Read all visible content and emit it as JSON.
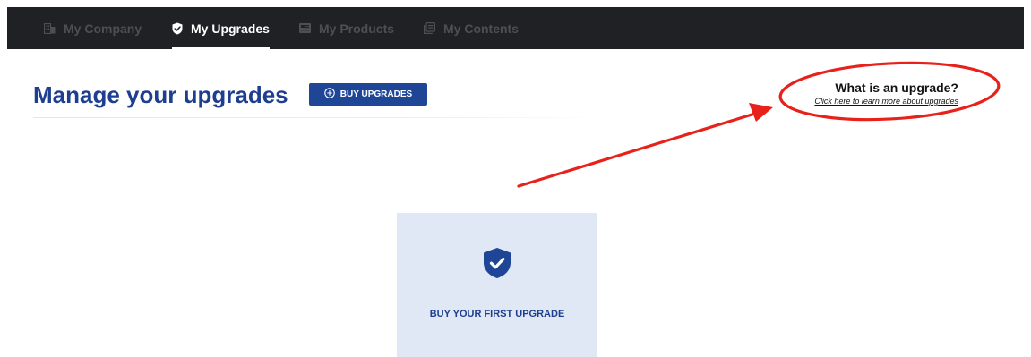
{
  "nav": {
    "tabs": [
      {
        "label": "My Company",
        "icon": "building-icon",
        "active": false
      },
      {
        "label": "My Upgrades",
        "icon": "shield-check-icon",
        "active": true
      },
      {
        "label": "My Products",
        "icon": "products-icon",
        "active": false
      },
      {
        "label": "My Contents",
        "icon": "contents-icon",
        "active": false
      }
    ]
  },
  "main": {
    "title": "Manage your upgrades",
    "buy_button_label": "BUY UPGRADES",
    "buy_button_icon": "plus-circle-icon"
  },
  "info": {
    "heading": "What is an upgrade?",
    "link": "Click here to learn more about upgrades"
  },
  "card": {
    "label": "BUY YOUR FIRST UPGRADE",
    "icon": "shield-check-icon"
  },
  "annotation": {
    "color": "#e8211a",
    "shapes": [
      "ellipse",
      "arrow"
    ]
  },
  "colors": {
    "navbar": "#1f2124",
    "brand_blue": "#1e4596",
    "title_blue": "#1e3f8f",
    "card_bg": "#dfe8f4"
  }
}
